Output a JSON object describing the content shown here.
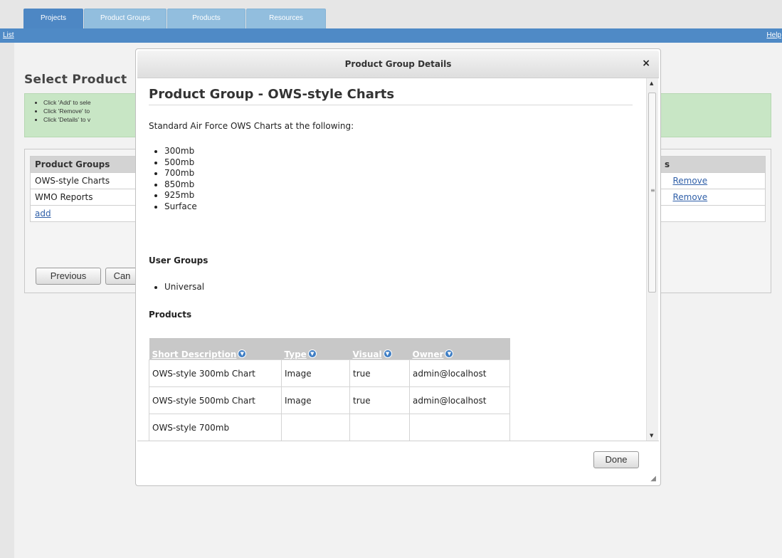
{
  "tabs": [
    {
      "label": "Projects"
    },
    {
      "label": "Product Groups"
    },
    {
      "label": "Products"
    },
    {
      "label": "Resources"
    }
  ],
  "subnav": {
    "left": "List",
    "right": "Help"
  },
  "page": {
    "title": "Select Product",
    "instructions": [
      "Click 'Add' to sele",
      "Click 'Remove' to",
      "Click 'Details' to v"
    ],
    "groups_header": [
      "Product Groups",
      "s"
    ],
    "groups_rows": [
      {
        "name": "OWS-style Charts",
        "action": "Remove"
      },
      {
        "name": "WMO Reports",
        "action": "Remove"
      }
    ],
    "add_link": "add",
    "prev_label": "Previous",
    "cancel_label": "Can"
  },
  "modal": {
    "title": "Product Group Details",
    "close": "×",
    "heading": "Product Group - OWS-style Charts",
    "description": "Standard Air Force OWS Charts at the following:",
    "levels": [
      "300mb",
      "500mb",
      "700mb",
      "850mb",
      "925mb",
      "Surface"
    ],
    "user_groups_heading": "User Groups",
    "user_groups": [
      "Universal"
    ],
    "products_heading": "Products",
    "products_columns": [
      "Short Description",
      "Type",
      "Visual",
      "Owner"
    ],
    "products_rows": [
      {
        "desc": "OWS-style 300mb Chart",
        "type": "Image",
        "visual": "true",
        "owner": "admin@localhost"
      },
      {
        "desc": "OWS-style 500mb Chart",
        "type": "Image",
        "visual": "true",
        "owner": "admin@localhost"
      },
      {
        "desc": "OWS-style 700mb",
        "type": "",
        "visual": "",
        "owner": ""
      }
    ],
    "done_label": "Done",
    "scroll_up": "▲",
    "scroll_down": "▼",
    "resize": "◢"
  },
  "colors": {
    "tab_active": "#4d87c4",
    "tab_inactive": "#92bede",
    "link": "#2f5fa8",
    "notice": "#c8e6c5"
  }
}
